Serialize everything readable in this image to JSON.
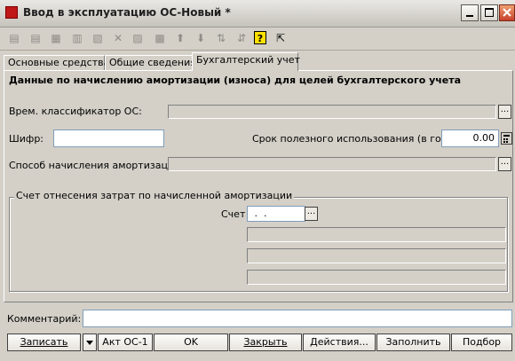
{
  "window": {
    "title": "Ввод в эксплуатацию ОС-Новый *"
  },
  "tabs": [
    {
      "label": "Основные средства"
    },
    {
      "label": "Общие сведения"
    },
    {
      "label": "Бухгалтерский учет"
    }
  ],
  "heading": "Данные по начислению амортизации (износа) для целей бухгалтерского учета",
  "fields": {
    "classifier_label": "Врем. классификатор ОС:",
    "cipher_label": "Шифр:",
    "cipher_value": "",
    "useful_life_label": "Срок полезного использования (в годах):",
    "useful_life_value": "0.00",
    "method_label": "Способ начисления амортизации:"
  },
  "expense_group": {
    "title": "Счет отнесения затрат по начисленной амортизации",
    "account_label": "Счет",
    "account_value": " .  ."
  },
  "comment": {
    "label": "Комментарий:",
    "value": ""
  },
  "buttons": {
    "save": "Записать",
    "act": "Акт ОС-1",
    "ok": "OK",
    "close": "Закрыть",
    "actions": "Действия...",
    "fill": "Заполнить",
    "select": "Подбор"
  }
}
